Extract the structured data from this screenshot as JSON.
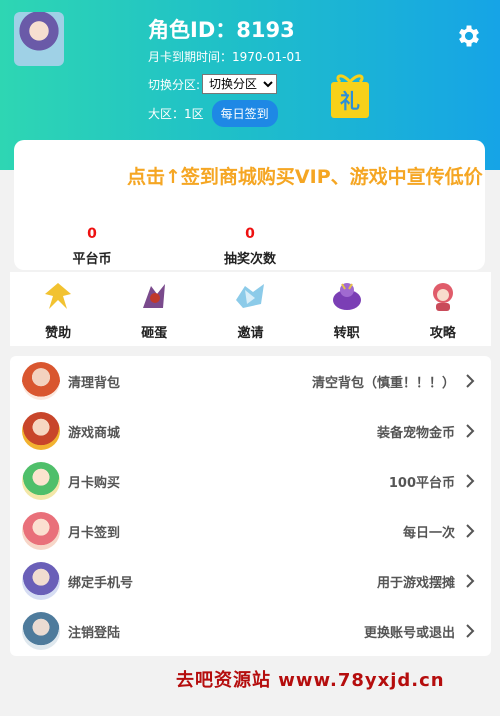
{
  "header": {
    "role_id": "角色ID：8193",
    "expiry": "月卡到期时间：1970-01-01",
    "switch_label": "切换分区:",
    "switch_value": "切换分区",
    "region": "大区：1区",
    "checkin_label": "每日签到",
    "gift_char": "礼"
  },
  "announcement": "点击↑签到商城购买VIP、游戏中宣传低价",
  "stats": [
    {
      "value": "0",
      "label": "平台币"
    },
    {
      "value": "0",
      "label": "抽奖次数"
    }
  ],
  "quick_icons": [
    {
      "label": "赞助",
      "icon": "sponsor-icon",
      "color": "#f2c230"
    },
    {
      "label": "砸蛋",
      "icon": "egg-icon",
      "color": "#c0392b"
    },
    {
      "label": "邀请",
      "icon": "invite-icon",
      "color": "#8ccbe9"
    },
    {
      "label": "转职",
      "icon": "class-change-icon",
      "color": "#7b3fb5"
    },
    {
      "label": "攻略",
      "icon": "guide-icon",
      "color": "#e05c6a"
    }
  ],
  "list": [
    {
      "title": "清理背包",
      "desc": "清空背包（慎重！！！）",
      "icon": "clean-bag-icon"
    },
    {
      "title": "游戏商城",
      "desc": "装备宠物金币",
      "icon": "shop-icon"
    },
    {
      "title": "月卡购买",
      "desc": "100平台币",
      "icon": "monthly-card-buy-icon"
    },
    {
      "title": "月卡签到",
      "desc": "每日一次",
      "icon": "monthly-card-checkin-icon"
    },
    {
      "title": "绑定手机号",
      "desc": "用于游戏摆摊",
      "icon": "bind-phone-icon"
    },
    {
      "title": "注销登陆",
      "desc": "更换账号或退出",
      "icon": "logout-icon"
    }
  ],
  "footer": "去吧资源站 www.78yxjd.cn",
  "colors": {
    "header_start": "#2ed6b3",
    "header_end": "#16a4e6",
    "accent_blue": "#1e88e5",
    "marquee": "#f5a623",
    "stat_red": "#ee1111",
    "footer_red": "#b50d0d"
  }
}
